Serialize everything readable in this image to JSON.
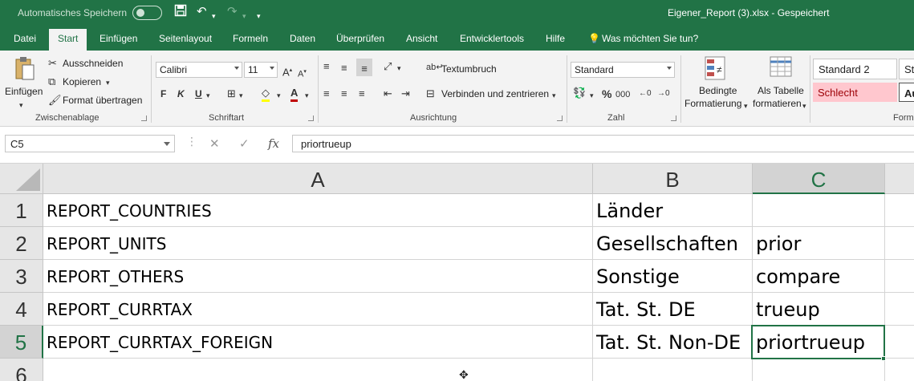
{
  "titlebar": {
    "autosave_label": "Automatisches Speichern",
    "doc_title": "Eigener_Report (3).xlsx  -  Gespeichert",
    "save_icon": "save-icon",
    "undo_icon": "undo-icon",
    "redo_icon": "redo-icon",
    "customize_icon": "chevron-down-icon"
  },
  "tabs": [
    "Datei",
    "Start",
    "Einfügen",
    "Seitenlayout",
    "Formeln",
    "Daten",
    "Überprüfen",
    "Ansicht",
    "Entwicklertools",
    "Hilfe",
    "Was möchten Sie tun?"
  ],
  "ribbon": {
    "clipboard": {
      "paste": "Einfügen",
      "cut": "Ausschneiden",
      "copy": "Kopieren",
      "format_painter": "Format übertragen",
      "label": "Zwischenablage"
    },
    "font": {
      "name": "Calibri",
      "size": "11",
      "bold": "F",
      "italic": "K",
      "underline": "U",
      "label": "Schriftart"
    },
    "alignment": {
      "wrap": "Textumbruch",
      "merge": "Verbinden und zentrieren",
      "label": "Ausrichtung"
    },
    "number": {
      "format": "Standard",
      "percent": "%",
      "thousands": "000",
      "label": "Zahl"
    },
    "styles": {
      "conditional_line1": "Bedingte",
      "conditional_line2": "Formatierung",
      "table_line1": "Als Tabelle",
      "table_line2": "formatieren",
      "style1": "Standard 2",
      "style2": "Schlecht",
      "style3": "St",
      "style4": "Au",
      "label": "Form"
    }
  },
  "formula_bar": {
    "name_box": "C5",
    "fx": "fx",
    "formula": "priortrueup"
  },
  "sheet": {
    "columns": [
      "A",
      "B",
      "C"
    ],
    "rows": [
      {
        "num": "1",
        "a": "REPORT_COUNTRIES",
        "b": "Länder",
        "c": ""
      },
      {
        "num": "2",
        "a": "REPORT_UNITS",
        "b": "Gesellschaften",
        "c": "prior"
      },
      {
        "num": "3",
        "a": "REPORT_OTHERS",
        "b": "Sonstige",
        "c": "compare"
      },
      {
        "num": "4",
        "a": "REPORT_CURRTAX",
        "b": "Tat. St. DE",
        "c": "trueup"
      },
      {
        "num": "5",
        "a": "REPORT_CURRTAX_FOREIGN",
        "b": "Tat. St. Non-DE",
        "c": "priortrueup"
      },
      {
        "num": "6",
        "a": "",
        "b": "",
        "c": ""
      }
    ],
    "selected_cell": "C5"
  },
  "colors": {
    "accent": "#217346",
    "bad_style_fill": "#ffc7ce",
    "bad_style_text": "#9c0006"
  }
}
